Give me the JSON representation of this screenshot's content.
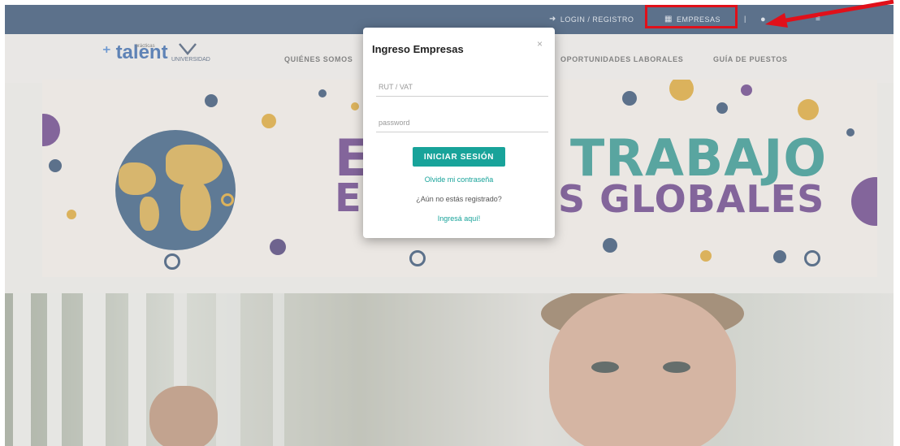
{
  "topbar": {
    "login_label": "LOGIN / REGISTRO",
    "empresas_label": "EMPRESAS",
    "separator": "|",
    "user_icon": "user-icon",
    "login_icon": "sign-in-icon",
    "empresas_icon": "building-icon"
  },
  "brand": {
    "logo_text": "talent",
    "logo_small": "prácticas",
    "crest_label": "UNIVERSIDAD"
  },
  "nav": {
    "items": [
      {
        "label": "QUIÉNES SOMOS"
      },
      {
        "label": "OPORTUNIDADES LABORALES"
      },
      {
        "label": "GUÍA DE PUESTOS"
      }
    ]
  },
  "banner": {
    "line1_left": "E",
    "line1_right": "TRABAJO",
    "line2_left": "E",
    "line2_right": "S GLOBALES"
  },
  "modal": {
    "title": "Ingreso Empresas",
    "close": "×",
    "rut_placeholder": "RUT / VAT",
    "password_placeholder": "password",
    "login_button": "INICIAR SESIÓN",
    "forgot_link": "Olvide mi contraseña",
    "not_registered": "¿Aún no estás registrado?",
    "register_link": "Ingresá aquí!"
  },
  "colors": {
    "topbar": "#1f3f66",
    "accent": "#18a39a",
    "highlight": "#e0101a"
  }
}
